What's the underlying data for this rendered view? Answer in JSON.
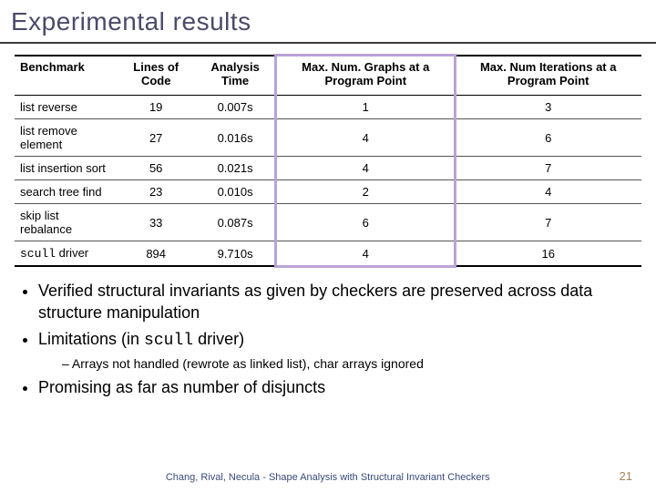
{
  "title": "Experimental results",
  "table": {
    "headers": {
      "c0": "Benchmark",
      "c1": "Lines of Code",
      "c2": "Analysis Time",
      "c3": "Max. Num. Graphs at a Program Point",
      "c4": "Max. Num Iterations at a Program Point"
    },
    "rows": [
      {
        "name": "list reverse",
        "mono": false,
        "loc": "19",
        "time": "0.007s",
        "graphs": "1",
        "iters": "3"
      },
      {
        "name": "list remove element",
        "mono": false,
        "loc": "27",
        "time": "0.016s",
        "graphs": "4",
        "iters": "6"
      },
      {
        "name": "list insertion sort",
        "mono": false,
        "loc": "56",
        "time": "0.021s",
        "graphs": "4",
        "iters": "7"
      },
      {
        "name": "search tree find",
        "mono": false,
        "loc": "23",
        "time": "0.010s",
        "graphs": "2",
        "iters": "4"
      },
      {
        "name": "skip list rebalance",
        "mono": false,
        "loc": "33",
        "time": "0.087s",
        "graphs": "6",
        "iters": "7"
      },
      {
        "name_prefix": "scull",
        "name_suffix": " driver",
        "mono": true,
        "loc": "894",
        "time": "9.710s",
        "graphs": "4",
        "iters": "16"
      }
    ]
  },
  "bullets": {
    "b1": "Verified structural invariants as given by checkers are preserved across data structure manipulation",
    "b2_prefix": "Limitations (in ",
    "b2_mono": "scull",
    "b2_suffix": " driver)",
    "b2_sub": "Arrays not handled (rewrote as linked list), char arrays ignored",
    "b3": "Promising as far as number of disjuncts"
  },
  "footer": {
    "text": "Chang, Rival, Necula - Shape Analysis with Structural Invariant Checkers",
    "page": "21"
  }
}
